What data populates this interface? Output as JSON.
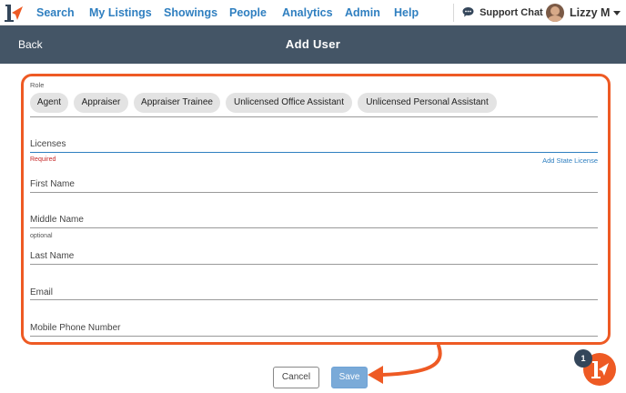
{
  "nav": {
    "brand_icon": "r-logo-icon",
    "links": [
      "Search",
      "My Listings",
      "Showings",
      "People",
      "Analytics",
      "Admin",
      "Help"
    ],
    "support_label": "Support Chat",
    "support_icon": "chat-bubble-icon",
    "user_name": "Lizzy M"
  },
  "header": {
    "back_label": "Back",
    "title": "Add User"
  },
  "form": {
    "role_label": "Role",
    "roles": [
      "Agent",
      "Appraiser",
      "Appraiser Trainee",
      "Unlicensed Office Assistant",
      "Unlicensed Personal Assistant"
    ],
    "licenses_label": "Licenses",
    "licenses_required": "Required",
    "add_state_license": "Add State License",
    "first_name_label": "First Name",
    "middle_name_label": "Middle Name",
    "middle_name_hint": "optional",
    "last_name_label": "Last Name",
    "email_label": "Email",
    "mobile_label": "Mobile Phone Number"
  },
  "actions": {
    "cancel_label": "Cancel",
    "save_label": "Save"
  },
  "help": {
    "badge_count": "1"
  },
  "colors": {
    "brand_blue": "#2f7fc0",
    "header_bg": "#445566",
    "annotation_orange": "#ee5a24",
    "required_red": "#c62828",
    "save_button": "#7aaad8"
  }
}
